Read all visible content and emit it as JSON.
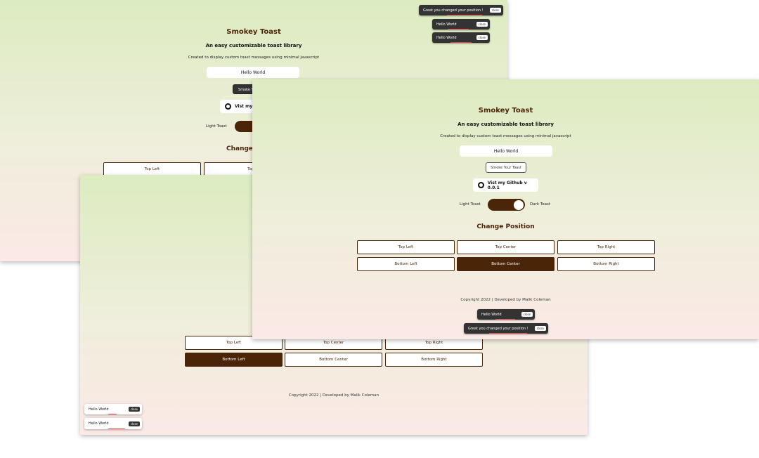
{
  "app": {
    "title": "Smokey Toast",
    "tagline": "An easy customizable toast library",
    "description": "Created to display custom toast messages using minimal javascript",
    "message_value": "Hello World",
    "smoke_button": "Smoke Your Toast",
    "smoke_button_cropped": "Smoke Yo",
    "github_button": "Vist my Github v 0.0.1",
    "github_button_cropped": "Vist my",
    "light_label": "Light Toast",
    "dark_label": "Dark Toast",
    "position_heading": "Change Position",
    "position_heading_cropped": "Change",
    "footer": "Copyright 2022 | Developed by Malik Coleman"
  },
  "positions": {
    "top_left": "Top Left",
    "top_center": "Top Center",
    "top_center_cropped": "Top C",
    "top_right": "Top Right",
    "bottom_left": "Bottom Left",
    "bottom_center": "Bottom Center",
    "bottom_right": "Bottom Right"
  },
  "toasts": {
    "position_changed": "Great you changed your position !",
    "hello": "Hello World",
    "close": "close"
  },
  "screens": {
    "back": {
      "theme": "dark",
      "active_position": "top_right"
    },
    "middle": {
      "theme": "light",
      "active_position": "bottom_left"
    },
    "front": {
      "theme": "dark",
      "active_position": "bottom_center"
    }
  },
  "colors": {
    "brand_brown": "#4a2508",
    "toast_dark": "#333333",
    "progress_red": "#e04848",
    "bg_top": "#dcecc0",
    "bg_bottom": "#fbe9e6"
  }
}
